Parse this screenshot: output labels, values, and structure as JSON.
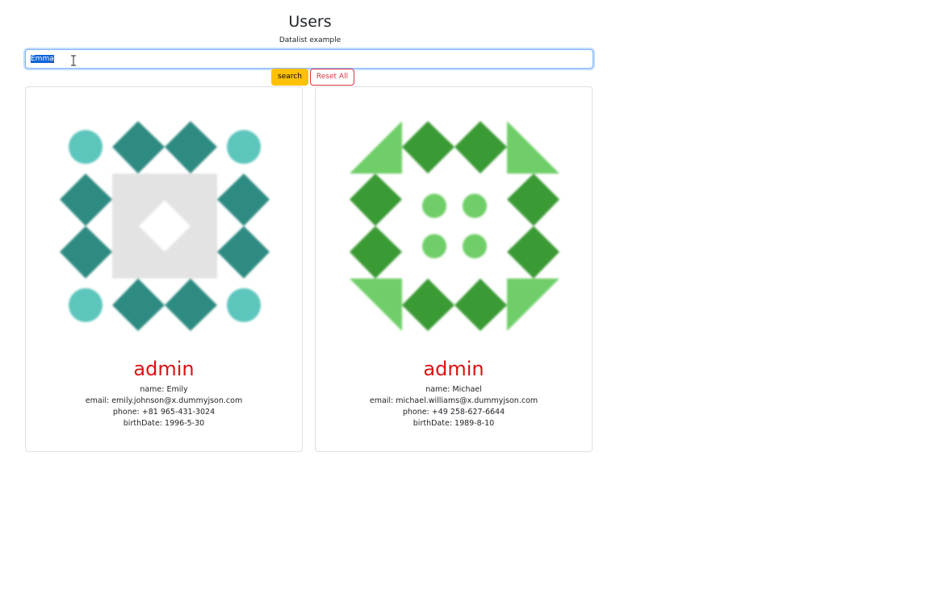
{
  "header": {
    "title": "Users",
    "subtitle": "Datalist example"
  },
  "search": {
    "value": "Emma",
    "search_label": "search",
    "reset_label": "Reset All"
  },
  "colors": {
    "search_button": "#ffc107",
    "reset_button": "#dc3545",
    "role_text": "#dc1212",
    "avatar1_dark": "#2e8b82",
    "avatar1_light": "#5cc6bd",
    "avatar1_center": "#e3e3e3",
    "avatar2_dark": "#3a9a34",
    "avatar2_light": "#6fce68"
  },
  "users": [
    {
      "role": "admin",
      "name_line": "name: Emily",
      "email_line": "email: emily.johnson@x.dummyjson.com",
      "phone_line": "phone: +81 965-431-3024",
      "birth_line": "birthDate: 1996-5-30",
      "avatar_icon": "identicon-teal"
    },
    {
      "role": "admin",
      "name_line": "name: Michael",
      "email_line": "email: michael.williams@x.dummyjson.com",
      "phone_line": "phone: +49 258-627-6644",
      "birth_line": "birthDate: 1989-8-10",
      "avatar_icon": "identicon-green"
    }
  ]
}
